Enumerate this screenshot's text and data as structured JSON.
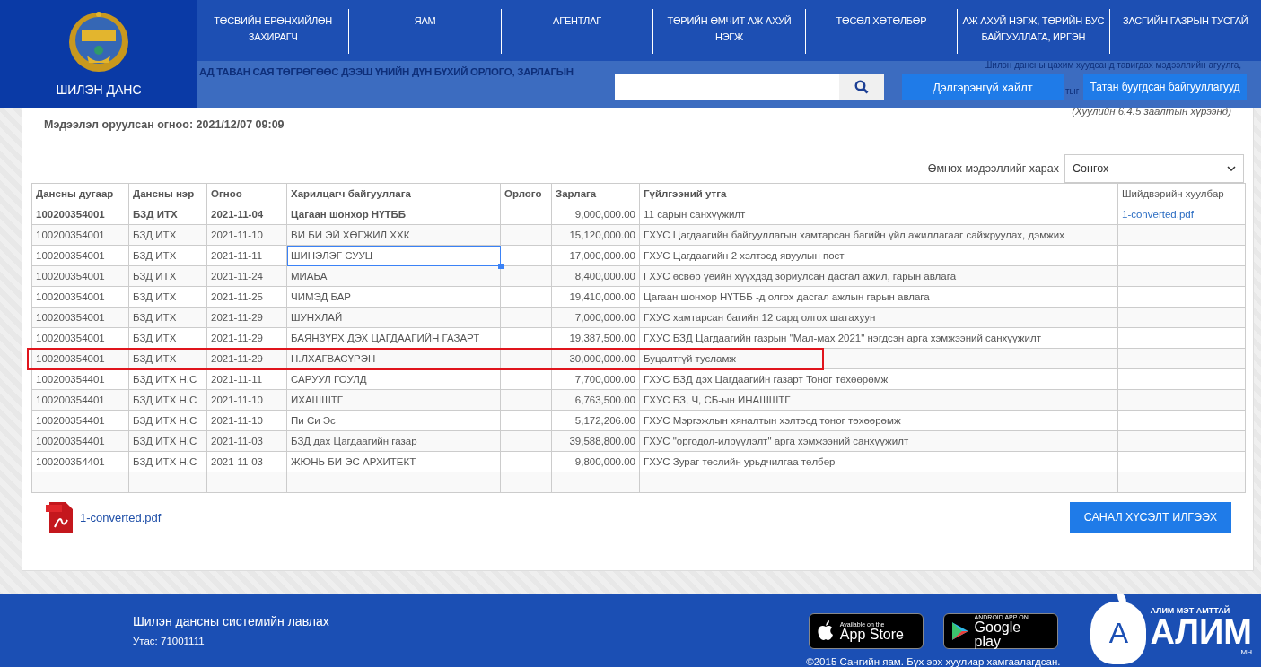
{
  "header": {
    "logo_text": "ШИЛЭН ДАНС",
    "nav": [
      {
        "label": "ТӨСВИЙН ЕРӨНХИЙЛӨН ЗАХИРАГЧ"
      },
      {
        "label": "ЯАМ"
      },
      {
        "label": "АГЕНТЛАГ"
      },
      {
        "label": "ТӨРИЙН ӨМЧИТ АЖ АХУЙ НЭГЖ"
      },
      {
        "label": "ТӨСӨЛ ХӨТӨЛБӨР"
      },
      {
        "label": "АЖ АХУЙ НЭГЖ, ТӨРИЙН БУС БАЙГУУЛЛАГА, ИРГЭН"
      },
      {
        "label": "ЗАСГИЙН ГАЗРЫН ТУСГАЙ"
      }
    ],
    "background_title": "АД ТАВАН САЯ ТӨГРӨГӨӨС ДЭЭШ ҮНИЙН ДҮН БҮХИЙ ОРЛОГО, ЗАРЛАГЫН",
    "background_note": "Шилэн дансны цахим хуудсанд тавигдах мэдээллийн агуулга,",
    "background_fragment": "тыг",
    "advanced_search": "Дэлгэрэнгүй хайлт",
    "closed_orgs": "Татан буугдсан байгууллагууд"
  },
  "panel": {
    "law_note": "(Хуулийн 6.4.5 заалтын хүрээнд)",
    "updated": "Мэдээлэл оруулсан огноо: 2021/12/07 09:09",
    "history_label": "Өмнөх мэдээллийг харах",
    "history_select": "Сонгох",
    "table": {
      "columns": [
        "Дансны дугаар",
        "Дансны нэр",
        "Огноо",
        "Харилцагч байгууллага",
        "Орлого",
        "Зарлага",
        "Гүйлгээний утга",
        "Шийдвэрийн хуулбар"
      ],
      "rows": [
        {
          "account": "100200354001",
          "name": "БЗД ИТХ",
          "date": "2021-11-04",
          "partner": "Цагаан шонхор НҮТББ",
          "expense": "9,000,000.00",
          "description": "11 сарын санхүүжилт",
          "file": "1-converted.pdf",
          "bold": true,
          "selected": false,
          "annotated": false
        },
        {
          "account": "100200354001",
          "name": "БЗД ИТХ",
          "date": "2021-11-10",
          "partner": "ВИ БИ ЭЙ ХӨГЖИЛ ХХК",
          "expense": "15,120,000.00",
          "description": "ГХУС Цагдаагийн байгууллагын хамтарсан багийн үйл ажиллагааг сайжруулах, дэмжих",
          "bold": false,
          "selected": false,
          "annotated": false
        },
        {
          "account": "100200354001",
          "name": "БЗД ИТХ",
          "date": "2021-11-11",
          "partner": "ШИНЭЛЭГ СУУЦ",
          "expense": "17,000,000.00",
          "description": "ГХУС Цагдаагийн 2 хэлтэсд явуулын пост",
          "bold": false,
          "selected": true,
          "annotated": false
        },
        {
          "account": "100200354001",
          "name": "БЗД ИТХ",
          "date": "2021-11-24",
          "partner": "МИАБА",
          "expense": "8,400,000.00",
          "description": "ГХУС өсвөр үеийн хүүхдэд зориулсан дасгал ажил, гарын авлага",
          "bold": false,
          "selected": false,
          "annotated": false
        },
        {
          "account": "100200354001",
          "name": "БЗД ИТХ",
          "date": "2021-11-25",
          "partner": "ЧИМЭД БАР",
          "expense": "19,410,000.00",
          "description": "Цагаан шонхор НҮТББ -д олгох дасгал ажлын гарын авлага",
          "bold": false,
          "selected": false,
          "annotated": false
        },
        {
          "account": "100200354001",
          "name": "БЗД ИТХ",
          "date": "2021-11-29",
          "partner": "ШУНХЛАЙ",
          "expense": "7,000,000.00",
          "description": "ГХУС хамтарсан багийн 12 сард олгох шатахуун",
          "bold": false,
          "selected": false,
          "annotated": false
        },
        {
          "account": "100200354001",
          "name": "БЗД ИТХ",
          "date": "2021-11-29",
          "partner": "БАЯНЗҮРХ ДЭХ ЦАГДААГИЙН ГАЗАРТ",
          "expense": "19,387,500.00",
          "description": "ГХУС БЗД Цагдаагийн газрын \"Мал-мах 2021\" нэгдсэн арга хэмжээний санхүүжилт",
          "bold": false,
          "selected": false,
          "annotated": false
        },
        {
          "account": "100200354001",
          "name": "БЗД ИТХ",
          "date": "2021-11-29",
          "partner": "Н.ЛХАГВАСҮРЭН",
          "expense": "30,000,000.00",
          "description": "Буцалтгүй тусламж",
          "bold": false,
          "selected": false,
          "annotated": true
        },
        {
          "account": "100200354401",
          "name": "БЗД ИТХ Н.С",
          "date": "2021-11-11",
          "partner": "САРУУЛ ГОУЛД",
          "expense": "7,700,000.00",
          "description": "ГХУС БЗД дэх Цагдаагийн газарт Тоног төхөөрөмж",
          "bold": false,
          "selected": false,
          "annotated": false
        },
        {
          "account": "100200354401",
          "name": "БЗД ИТХ Н.С",
          "date": "2021-11-10",
          "partner": "ИХАШШТГ",
          "expense": "6,763,500.00",
          "description": "ГХУС БЗ, Ч, СБ-ын ИНАШШТГ",
          "bold": false,
          "selected": false,
          "annotated": false
        },
        {
          "account": "100200354401",
          "name": "БЗД ИТХ Н.С",
          "date": "2021-11-10",
          "partner": "Пи Си Эс",
          "expense": "5,172,206.00",
          "description": "ГХУС Мэргэжлын хяналтын хэлтэсд тоног төхөөрөмж",
          "bold": false,
          "selected": false,
          "annotated": false
        },
        {
          "account": "100200354401",
          "name": "БЗД ИТХ Н.С",
          "date": "2021-11-03",
          "partner": "БЗД дах Цагдаагийн газар",
          "expense": "39,588,800.00",
          "description": "ГХУС \"оргодол-илрүүлэлт\" арга хэмжээний санхүүжилт",
          "bold": false,
          "selected": false,
          "annotated": false
        },
        {
          "account": "100200354401",
          "name": "БЗД ИТХ Н.С",
          "date": "2021-11-03",
          "partner": "ЖЮНЬ БИ ЭС АРХИТЕКТ",
          "expense": "9,800,000.00",
          "description": "ГХУС Зураг төслийн урьдчилгаа төлбөр",
          "bold": false,
          "selected": false,
          "annotated": false
        }
      ]
    },
    "attachment": "1-converted.pdf",
    "feedback_button": "САНАЛ ХҮСЭЛТ ИЛГЭЭХ"
  },
  "footer": {
    "title": "Шилэн дансны системийн лавлах",
    "phone": "Утас: 71001111",
    "appstore_small": "Available on the",
    "appstore_big": "App Store",
    "play_small": "ANDROID APP ON",
    "play_big": "Google play",
    "brand_slogan": "АЛИМ МЭТ АМТТАЙ",
    "brand_letter": "А",
    "brand_name": "АЛИМ",
    "brand_domain": ".МН",
    "copyright": "©2015 Сангийн яам. Бүх эрх хуулиар хамгаалагдсан."
  }
}
